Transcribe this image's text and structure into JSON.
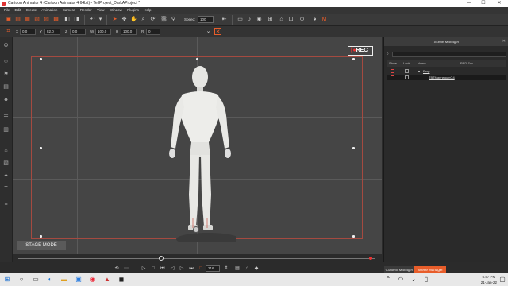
{
  "window": {
    "title": "Cartoon Animator 4 (Cartoon Animator 4 64bit) - TellProject_DarkAProject *",
    "minimize": "—",
    "maximize": "☐",
    "close": "✕"
  },
  "menu": [
    "File",
    "Edit",
    "Create",
    "Animation",
    "Camera",
    "Render",
    "View",
    "Window",
    "Plugins",
    "Help"
  ],
  "toolbar": {
    "speed_label": "Speed:",
    "speed_value": "100"
  },
  "transform": {
    "x_label": "X",
    "x_value": "0.0",
    "y_label": "Y",
    "y_value": "82.0",
    "z_label": "Z",
    "z_value": "0.0",
    "w_label": "W",
    "w_value": "100.0",
    "h_label": "H",
    "h_value": "100.0",
    "r_label": "R",
    "r_value": "0"
  },
  "viewport": {
    "rec_label": "REC",
    "stage_mode_label": "STAGE MODE"
  },
  "scene_manager": {
    "title": "Scene Manager",
    "columns": [
      "Show",
      "Lock",
      "Name",
      "PSD Exc"
    ],
    "rows": [
      {
        "name": "Prop",
        "indent": 0
      },
      {
        "name": "TBTMannequinG4",
        "indent": 1
      }
    ],
    "tabs": [
      "Content Manager",
      "Scene Manager"
    ],
    "active_tab": "Scene Manager"
  },
  "timeline": {
    "frame_value": "216",
    "playhead_fraction": 0.4
  },
  "taskbar": {
    "time": "5:47 PM",
    "date": "21-Jan-22"
  },
  "colors": {
    "accent": "#e85d2a",
    "guide": "#a54a40",
    "viewport_bg": "#454545"
  }
}
